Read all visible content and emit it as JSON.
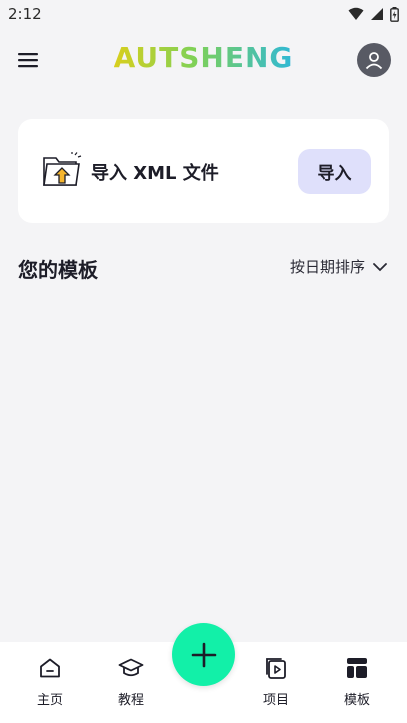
{
  "status_bar": {
    "time": "2:12",
    "icons": [
      "wifi-icon",
      "signal-icon",
      "battery-icon"
    ]
  },
  "app_bar": {
    "logo_text": "AUTSHENG",
    "menu_icon": "menu-icon",
    "avatar_icon": "user-icon"
  },
  "import_card": {
    "label": "导入 XML 文件",
    "button_label": "导入",
    "icon": "folder-upload-icon"
  },
  "templates": {
    "title": "您的模板",
    "sort_label": "按日期排序"
  },
  "bottom_nav": {
    "items": [
      {
        "label": "主页",
        "icon": "home-icon"
      },
      {
        "label": "教程",
        "icon": "graduation-cap-icon"
      },
      {
        "label": "项目",
        "icon": "video-file-icon"
      },
      {
        "label": "模板",
        "icon": "template-icon"
      }
    ],
    "fab_icon": "plus-icon"
  },
  "colors": {
    "fab": "#12f0a8",
    "import_button_bg": "#dfe0fb",
    "avatar_bg": "#585a64",
    "page_bg": "#f4f4f6"
  }
}
